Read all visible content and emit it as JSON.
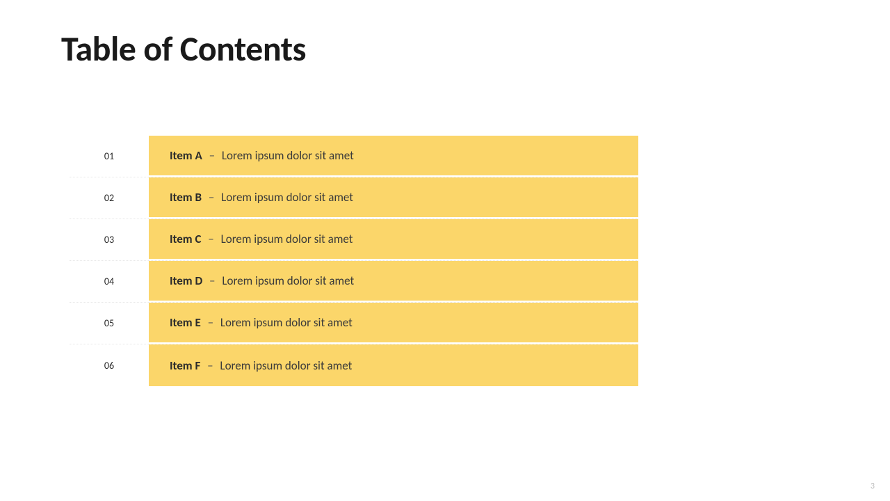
{
  "title": "Table of Contents",
  "rows": [
    {
      "num": "01",
      "name": "Item A",
      "desc": "Lorem ipsum dolor sit amet"
    },
    {
      "num": "02",
      "name": "Item B",
      "desc": "Lorem ipsum dolor sit amet"
    },
    {
      "num": "03",
      "name": "Item C",
      "desc": "Lorem ipsum dolor sit amet"
    },
    {
      "num": "04",
      "name": "Item D",
      "desc": "Lorem ipsum dolor sit amet"
    },
    {
      "num": "05",
      "name": "Item E",
      "desc": "Lorem ipsum dolor sit amet"
    },
    {
      "num": "06",
      "name": "Item F",
      "desc": "Lorem ipsum dolor sit amet"
    }
  ],
  "separator": "–",
  "page_number": "3"
}
